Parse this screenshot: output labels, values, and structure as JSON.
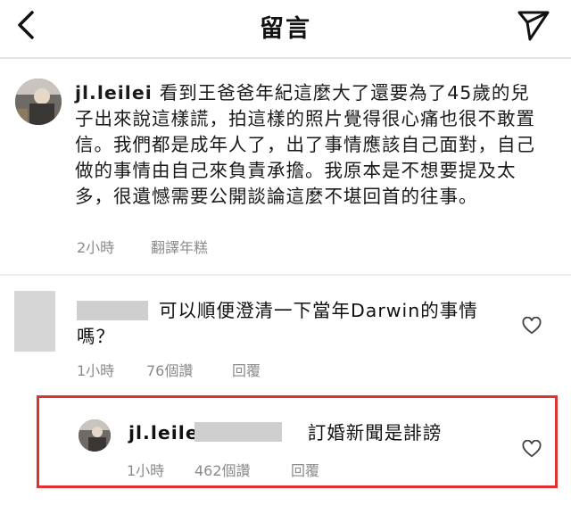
{
  "header": {
    "title": "留言"
  },
  "caption": {
    "username": "jl.leilei",
    "text": "看到王爸爸年紀這麼大了還要為了45歲的兒子出來說這樣謊，拍這樣的照片覺得很心痛也很不敢置信。我們都是成年人了，出了事情應該自己面對，自己做的事情由自己來負責承擔。我原本是不想要提及太多，很遺憾需要公開談論這麼不堪回首的往事。",
    "time": "2小時",
    "translate": "翻譯年糕"
  },
  "comments": [
    {
      "text": "可以順便澄清一下當年Darwin的事情嗎？",
      "time": "1小時",
      "likes": "76個讚",
      "reply": "回覆"
    },
    {
      "username": "jl.leilei",
      "text": "訂婚新聞是誹謗",
      "time": "1小時",
      "likes": "462個讚",
      "reply": "回覆",
      "highlight_color": "#e03030"
    }
  ]
}
